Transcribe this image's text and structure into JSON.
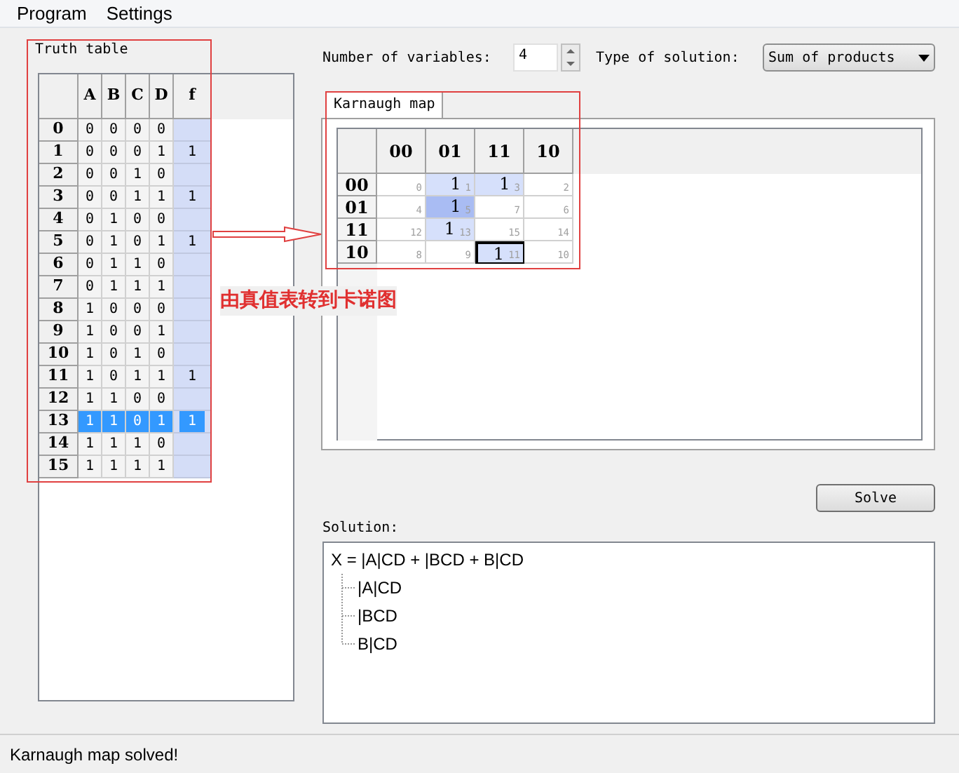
{
  "menu": [
    "Program",
    "Settings"
  ],
  "truth_table": {
    "title": "Truth table",
    "columns": [
      "A",
      "B",
      "C",
      "D",
      "f"
    ],
    "rows": [
      {
        "index": "0",
        "inputs": [
          "0",
          "0",
          "0",
          "0"
        ],
        "selected": false
      },
      {
        "index": "1",
        "inputs": [
          "0",
          "0",
          "0",
          "1"
        ],
        "f": "1",
        "selected": false
      },
      {
        "index": "2",
        "inputs": [
          "0",
          "0",
          "1",
          "0"
        ],
        "selected": false
      },
      {
        "index": "3",
        "inputs": [
          "0",
          "0",
          "1",
          "1"
        ],
        "f": "1",
        "selected": false
      },
      {
        "index": "4",
        "inputs": [
          "0",
          "1",
          "0",
          "0"
        ],
        "selected": false
      },
      {
        "index": "5",
        "inputs": [
          "0",
          "1",
          "0",
          "1"
        ],
        "f": "1",
        "selected": false
      },
      {
        "index": "6",
        "inputs": [
          "0",
          "1",
          "1",
          "0"
        ],
        "selected": false
      },
      {
        "index": "7",
        "inputs": [
          "0",
          "1",
          "1",
          "1"
        ],
        "selected": false
      },
      {
        "index": "8",
        "inputs": [
          "1",
          "0",
          "0",
          "0"
        ],
        "selected": false
      },
      {
        "index": "9",
        "inputs": [
          "1",
          "0",
          "0",
          "1"
        ],
        "selected": false
      },
      {
        "index": "10",
        "inputs": [
          "1",
          "0",
          "1",
          "0"
        ],
        "selected": false
      },
      {
        "index": "11",
        "inputs": [
          "1",
          "0",
          "1",
          "1"
        ],
        "f": "1",
        "selected": false
      },
      {
        "index": "12",
        "inputs": [
          "1",
          "1",
          "0",
          "0"
        ],
        "selected": false
      },
      {
        "index": "13",
        "inputs": [
          "1",
          "1",
          "0",
          "1"
        ],
        "f": "1",
        "selected": true
      },
      {
        "index": "14",
        "inputs": [
          "1",
          "1",
          "1",
          "0"
        ],
        "selected": false
      },
      {
        "index": "15",
        "inputs": [
          "1",
          "1",
          "1",
          "1"
        ],
        "selected": false
      }
    ]
  },
  "variables": {
    "label": "Number of variables:",
    "value": "4"
  },
  "solution_type": {
    "label": "Type of solution:",
    "value": "Sum of products"
  },
  "tabs": [
    {
      "label": "Karnaugh map",
      "selected": true
    }
  ],
  "karnaugh_map": {
    "columns": [
      "00",
      "01",
      "11",
      "10"
    ],
    "rows": [
      {
        "label": "00",
        "cells": [
          {
            "index": "0",
            "color": "#ffffff",
            "selected": false
          },
          {
            "value": "1",
            "index": "1",
            "color": "#d6e0fb",
            "selected": false
          },
          {
            "value": "1",
            "index": "3",
            "color": "#d6e0fb",
            "selected": false
          },
          {
            "index": "2",
            "color": "#ffffff",
            "selected": false
          }
        ]
      },
      {
        "label": "01",
        "cells": [
          {
            "index": "4",
            "color": "#ffffff",
            "selected": false
          },
          {
            "value": "1",
            "index": "5",
            "color": "#a9bcf3",
            "selected": false
          },
          {
            "index": "7",
            "color": "#ffffff",
            "selected": false
          },
          {
            "index": "6",
            "color": "#ffffff",
            "selected": false
          }
        ]
      },
      {
        "label": "11",
        "cells": [
          {
            "index": "12",
            "color": "#ffffff",
            "selected": false
          },
          {
            "value": "1",
            "index": "13",
            "color": "#d6e0fb",
            "selected": false
          },
          {
            "index": "15",
            "color": "#ffffff",
            "selected": false
          },
          {
            "index": "14",
            "color": "#ffffff",
            "selected": false
          }
        ]
      },
      {
        "label": "10",
        "cells": [
          {
            "index": "8",
            "color": "#ffffff",
            "selected": false
          },
          {
            "index": "9",
            "color": "#ffffff",
            "selected": false
          },
          {
            "value": "1",
            "index": "11",
            "color": "#d6e0fb",
            "selected": true
          },
          {
            "index": "10",
            "color": "#ffffff",
            "selected": false
          }
        ]
      }
    ]
  },
  "annotation": "由真值表转到卡诺图",
  "solve_button": "Solve",
  "solution": {
    "label": "Solution:",
    "tree": {
      "text": "X = |A|CD + |BCD + B|CD",
      "children": [
        {
          "text": "|A|CD"
        },
        {
          "text": "|BCD"
        },
        {
          "text": "B|CD"
        }
      ]
    }
  },
  "status_bar": "Karnaugh map solved!"
}
